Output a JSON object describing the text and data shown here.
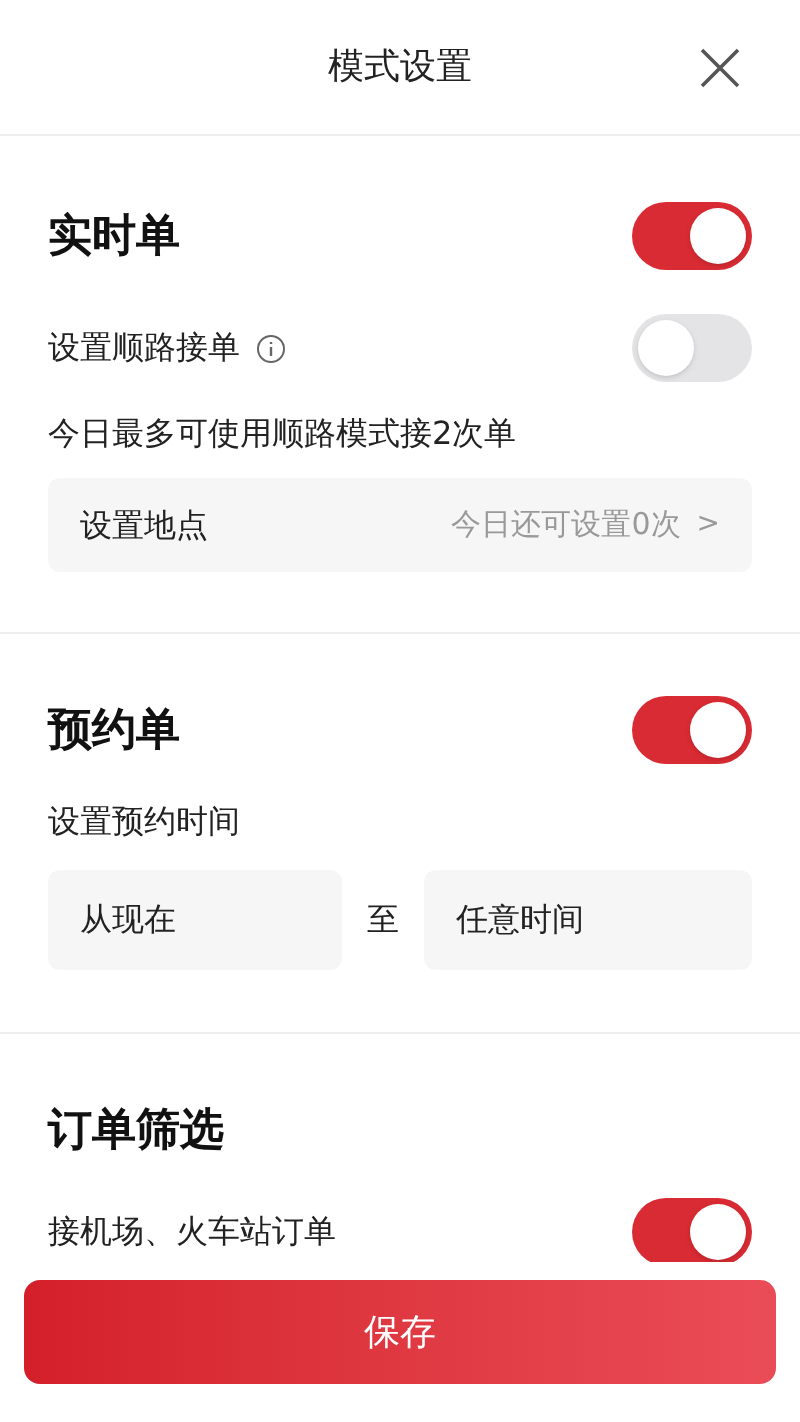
{
  "header": {
    "title": "模式设置"
  },
  "realtime": {
    "title": "实时单",
    "on": true,
    "route": {
      "label": "设置顺路接单",
      "on": false
    },
    "limit_note": "今日最多可使用顺路模式接2次单",
    "location_row": {
      "label": "设置地点",
      "value": "今日还可设置0次",
      "chevron": ">"
    }
  },
  "reservation": {
    "title": "预约单",
    "on": true,
    "time_label": "设置预约时间",
    "from": "从现在",
    "separator": "至",
    "to": "任意时间"
  },
  "filter": {
    "title": "订单筛选",
    "rows": [
      {
        "label": "接机场、火车站订单",
        "on": true
      }
    ]
  },
  "save_button": "保存"
}
